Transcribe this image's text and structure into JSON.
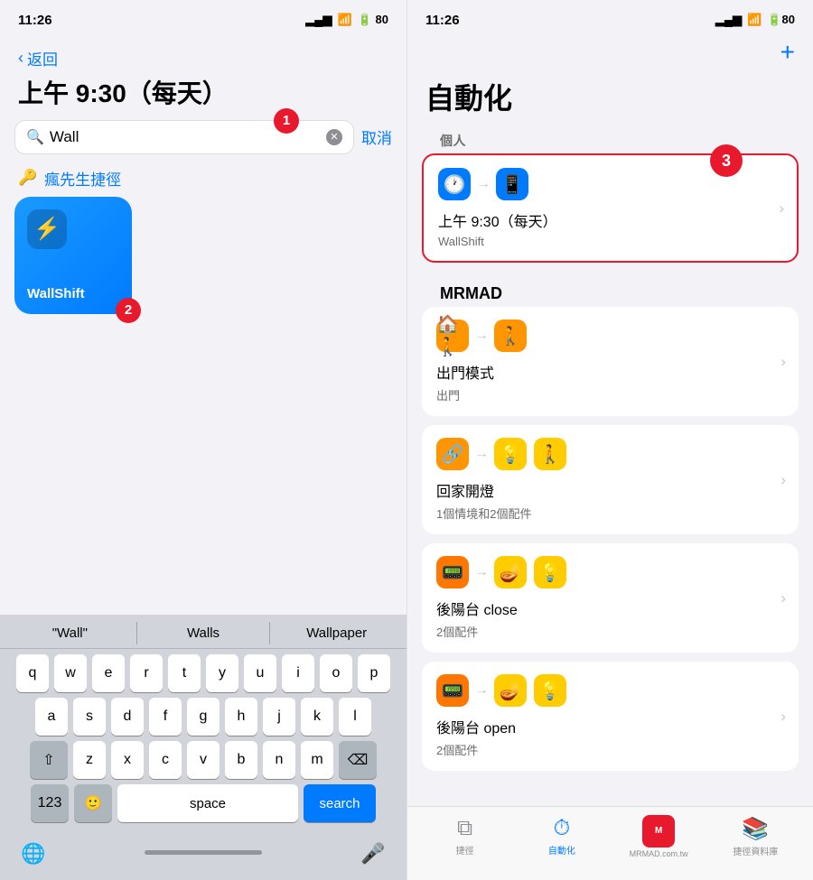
{
  "left": {
    "status": {
      "time": "11:26",
      "signal": "▂▄▆",
      "wifi": "WiFi",
      "battery": "80"
    },
    "back_label": "返回",
    "page_title": "上午 9:30（每天）",
    "search": {
      "placeholder": "Wall",
      "value": "Wall",
      "cancel_label": "取消"
    },
    "section_label": "瘋先生捷徑",
    "shortcut_name": "WallShift",
    "badge1": "1",
    "badge2": "2",
    "suggestions": [
      "\"Wall\"",
      "Walls",
      "Wallpaper"
    ],
    "keyboard": {
      "row1": [
        "q",
        "w",
        "e",
        "r",
        "t",
        "y",
        "u",
        "i",
        "o",
        "p"
      ],
      "row2": [
        "a",
        "s",
        "d",
        "f",
        "g",
        "h",
        "j",
        "k",
        "l"
      ],
      "row3": [
        "z",
        "x",
        "c",
        "v",
        "b",
        "n",
        "m"
      ],
      "space_label": "space",
      "search_label": "search",
      "num_label": "123",
      "delete_label": "⌫"
    }
  },
  "right": {
    "status": {
      "time": "11:26"
    },
    "add_label": "+",
    "page_title": "自動化",
    "section_personal": "個人",
    "badge3": "3",
    "automation_personal": {
      "title": "上午 9:30（每天）",
      "subtitle": "WallShift"
    },
    "section_mrmad": "MRMAD",
    "automations": [
      {
        "title": "出門模式",
        "subtitle": "出門"
      },
      {
        "title": "回家開燈",
        "subtitle": "1個情境和2個配件"
      },
      {
        "title": "後陽台 close",
        "subtitle": "2個配件"
      },
      {
        "title": "後陽台 open",
        "subtitle": "2個配件"
      }
    ],
    "tabs": [
      {
        "label": "捷徑",
        "icon": "⧉",
        "active": false
      },
      {
        "label": "自動化",
        "icon": "⏱",
        "active": true
      },
      {
        "label": "捷徑資料庫",
        "icon": "📚",
        "active": false
      }
    ]
  }
}
